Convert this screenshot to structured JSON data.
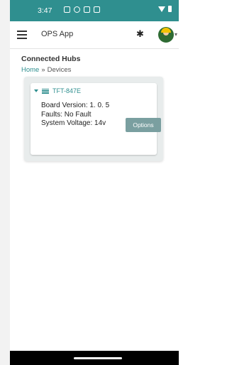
{
  "status_bar": {
    "time": "3:47",
    "icons": [
      "square-icon",
      "circle-icon",
      "calendar-icon",
      "calendar-icon",
      "wifi-icon",
      "battery-icon"
    ]
  },
  "app_bar": {
    "title": "OPS App",
    "icons": [
      "menu-icon",
      "bluetooth-icon",
      "avatar",
      "chevron-down-icon"
    ]
  },
  "page": {
    "heading": "Connected Hubs",
    "breadcrumb": {
      "home": "Home",
      "separator": "»",
      "current": "Devices"
    }
  },
  "device_card": {
    "name": "TFT-847E",
    "lines": [
      "Board Version: 1. 0. 5",
      "Faults: No Fault",
      "System Voltage: 14v"
    ],
    "options_label": "Options"
  },
  "colors": {
    "accent": "#2f8f8f",
    "button": "#7a9fa0",
    "panel": "#e8ecec"
  }
}
